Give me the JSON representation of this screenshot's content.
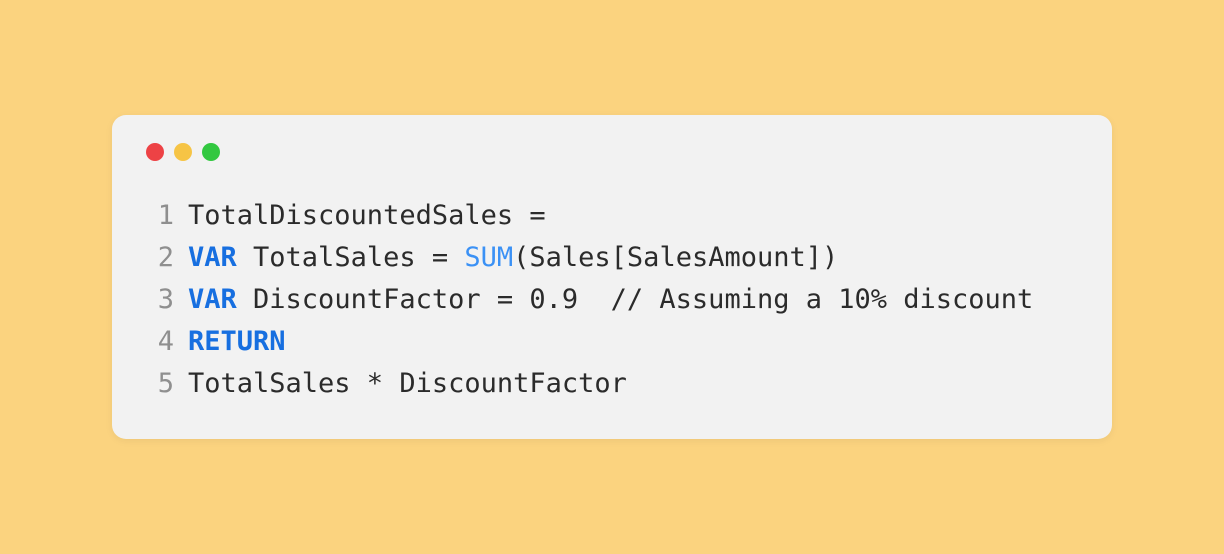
{
  "window": {
    "traffic_lights": {
      "red": "#ed4245",
      "yellow": "#f6c445",
      "green": "#32c840"
    }
  },
  "code": {
    "lines": [
      {
        "num": "1",
        "segments": [
          {
            "text": "TotalDiscountedSales = "
          }
        ]
      },
      {
        "num": "2",
        "segments": [
          {
            "text": "VAR",
            "cls": "kw"
          },
          {
            "text": " TotalSales = "
          },
          {
            "text": "SUM",
            "cls": "fn"
          },
          {
            "text": "(Sales[SalesAmount])"
          }
        ]
      },
      {
        "num": "3",
        "segments": [
          {
            "text": "VAR",
            "cls": "kw"
          },
          {
            "text": " DiscountFactor = 0.9  // Assuming a 10% discount"
          }
        ]
      },
      {
        "num": "4",
        "segments": [
          {
            "text": "RETURN",
            "cls": "kw"
          }
        ]
      },
      {
        "num": "5",
        "segments": [
          {
            "text": "TotalSales * DiscountFactor"
          }
        ]
      }
    ]
  }
}
